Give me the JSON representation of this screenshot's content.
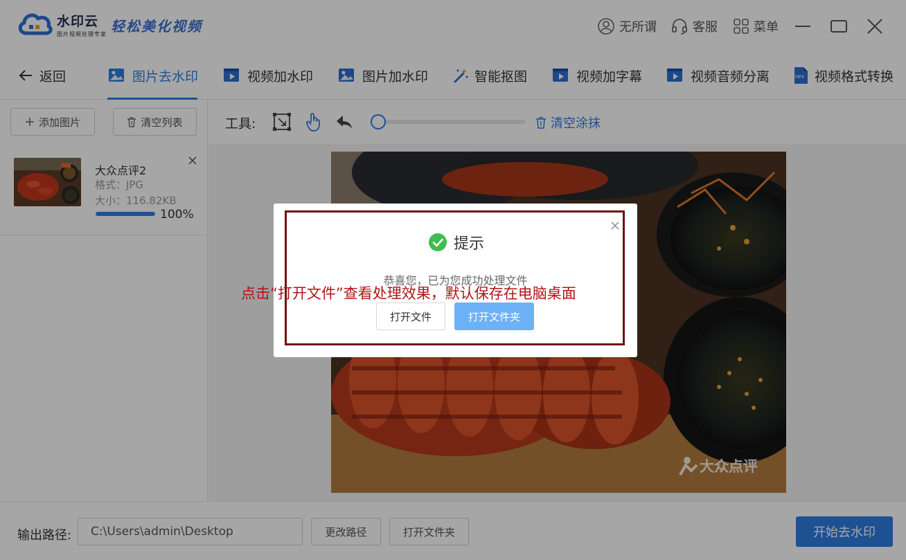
{
  "app": {
    "brand_name": "水印云",
    "brand_sub": "图片视频处理专家",
    "slogan": "轻松美化视频"
  },
  "titlebar": {
    "user_label": "无所谓",
    "service_label": "客服",
    "menu_label": "菜单",
    "icons": [
      "user-icon",
      "headset-icon",
      "grid-menu-icon",
      "minimize-icon",
      "maximize-icon",
      "close-icon"
    ]
  },
  "nav": {
    "back_label": "返回",
    "tabs": [
      {
        "label": "图片去水印",
        "icon": "image-icon",
        "active": true
      },
      {
        "label": "视频加水印",
        "icon": "video-icon",
        "active": false
      },
      {
        "label": "图片加水印",
        "icon": "image-icon",
        "active": false
      },
      {
        "label": "智能抠图",
        "icon": "magic-wand-icon",
        "active": false
      },
      {
        "label": "视频加字幕",
        "icon": "video-icon",
        "active": false
      },
      {
        "label": "视频音频分离",
        "icon": "video-icon",
        "active": false
      },
      {
        "label": "视频格式转换",
        "icon": "mp4-file-icon",
        "active": false
      }
    ],
    "accent": "#2d7de0"
  },
  "left_panel": {
    "add_label": "添加图片",
    "clear_label": "清空列表",
    "files": [
      {
        "name": "大众点评2",
        "format": "格式：JPG",
        "size": "大小：116.82KB",
        "progress": 1.0,
        "progress_text": "100%"
      }
    ]
  },
  "toolbar": {
    "label": "工具:",
    "tools": [
      "select-rect-icon",
      "hand-icon",
      "undo-icon"
    ],
    "brush_size": 0.03,
    "clear_label": "清空涂抹"
  },
  "preview": {
    "watermark_text": "大众点评"
  },
  "bottombar": {
    "output_label": "输出路径:",
    "output_path": "C:\\Users\\admin\\Desktop",
    "change_path_label": "更改路径",
    "open_folder_label": "打开文件夹",
    "start_label": "开始去水印"
  },
  "dialog": {
    "title": "提示",
    "message": "恭喜您，已为您成功处理文件",
    "open_file_label": "打开文件",
    "open_folder_label": "打开文件夹"
  },
  "annotation": {
    "text": "点击“打开文件”查看处理效果，默认保存在电脑桌面",
    "color": "#b01515"
  }
}
